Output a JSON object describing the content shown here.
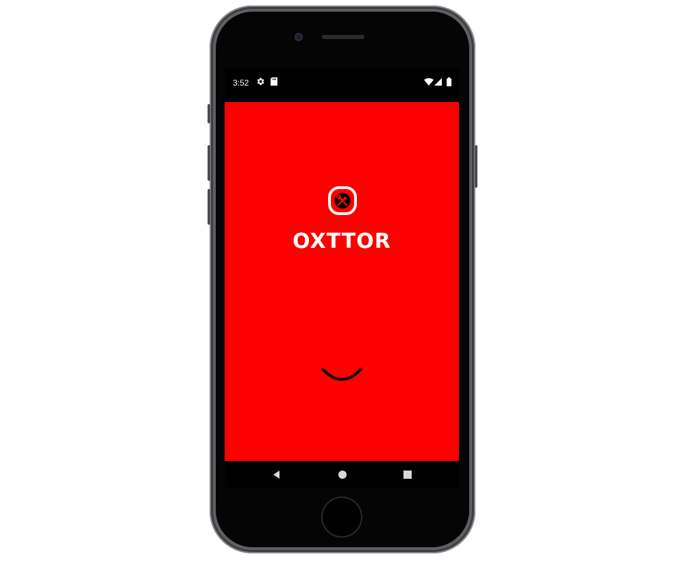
{
  "status_bar": {
    "time": "3:52",
    "left_icons": [
      "settings-gear-icon",
      "sd-card-icon"
    ],
    "right_icons": [
      "wifi-icon",
      "cellular-signal-icon",
      "battery-icon"
    ]
  },
  "splash": {
    "app_name": "OXTTOR",
    "logo_icon": "wrench-screwdriver-icon",
    "background_color": "#ff0000",
    "loading_indicator": "spinner"
  },
  "nav_bar": {
    "buttons": [
      "back",
      "home",
      "recents"
    ]
  },
  "device": {
    "model": "phone-frame"
  }
}
